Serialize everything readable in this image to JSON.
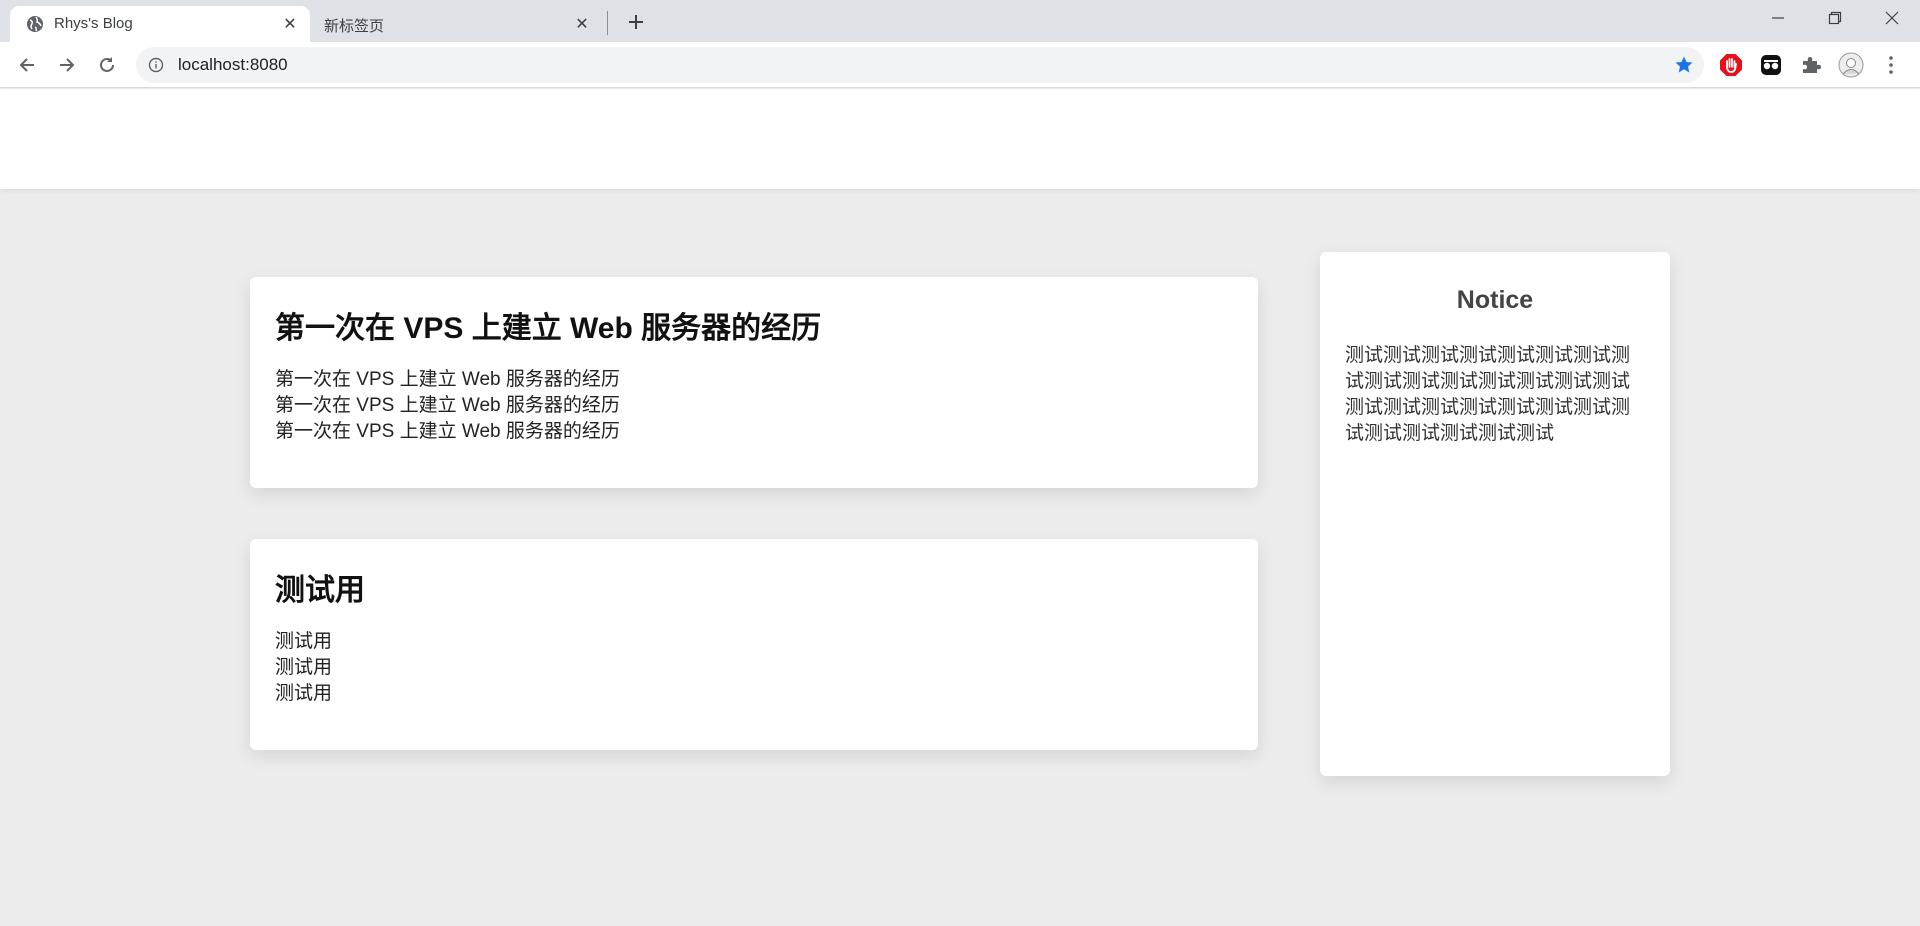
{
  "browser": {
    "tabs": [
      {
        "title": "Rhys's Blog",
        "active": true,
        "favicon": "globe-icon"
      },
      {
        "title": "新标签页",
        "active": false
      }
    ],
    "url": "localhost:8080",
    "bookmarked": true,
    "star_color": "#1a73e8",
    "extensions": [
      "adblock-hand-icon",
      "incognito-glasses-icon",
      "puzzle-icon",
      "avatar"
    ]
  },
  "page": {
    "posts": [
      {
        "title": "第一次在 VPS 上建立 Web 服务器的经历",
        "lines": [
          "第一次在 VPS 上建立 Web 服务器的经历",
          "第一次在 VPS 上建立 Web 服务器的经历",
          "第一次在 VPS 上建立 Web 服务器的经历"
        ]
      },
      {
        "title": "测试用",
        "lines": [
          "测试用",
          "测试用",
          "测试用"
        ]
      }
    ],
    "notice": {
      "title": "Notice",
      "body": "测试测试测试测试测试测试测试测试测试测试测试测试测试测试测试测试测试测试测试测试测试测试测试测试测试测试测试测试"
    }
  }
}
